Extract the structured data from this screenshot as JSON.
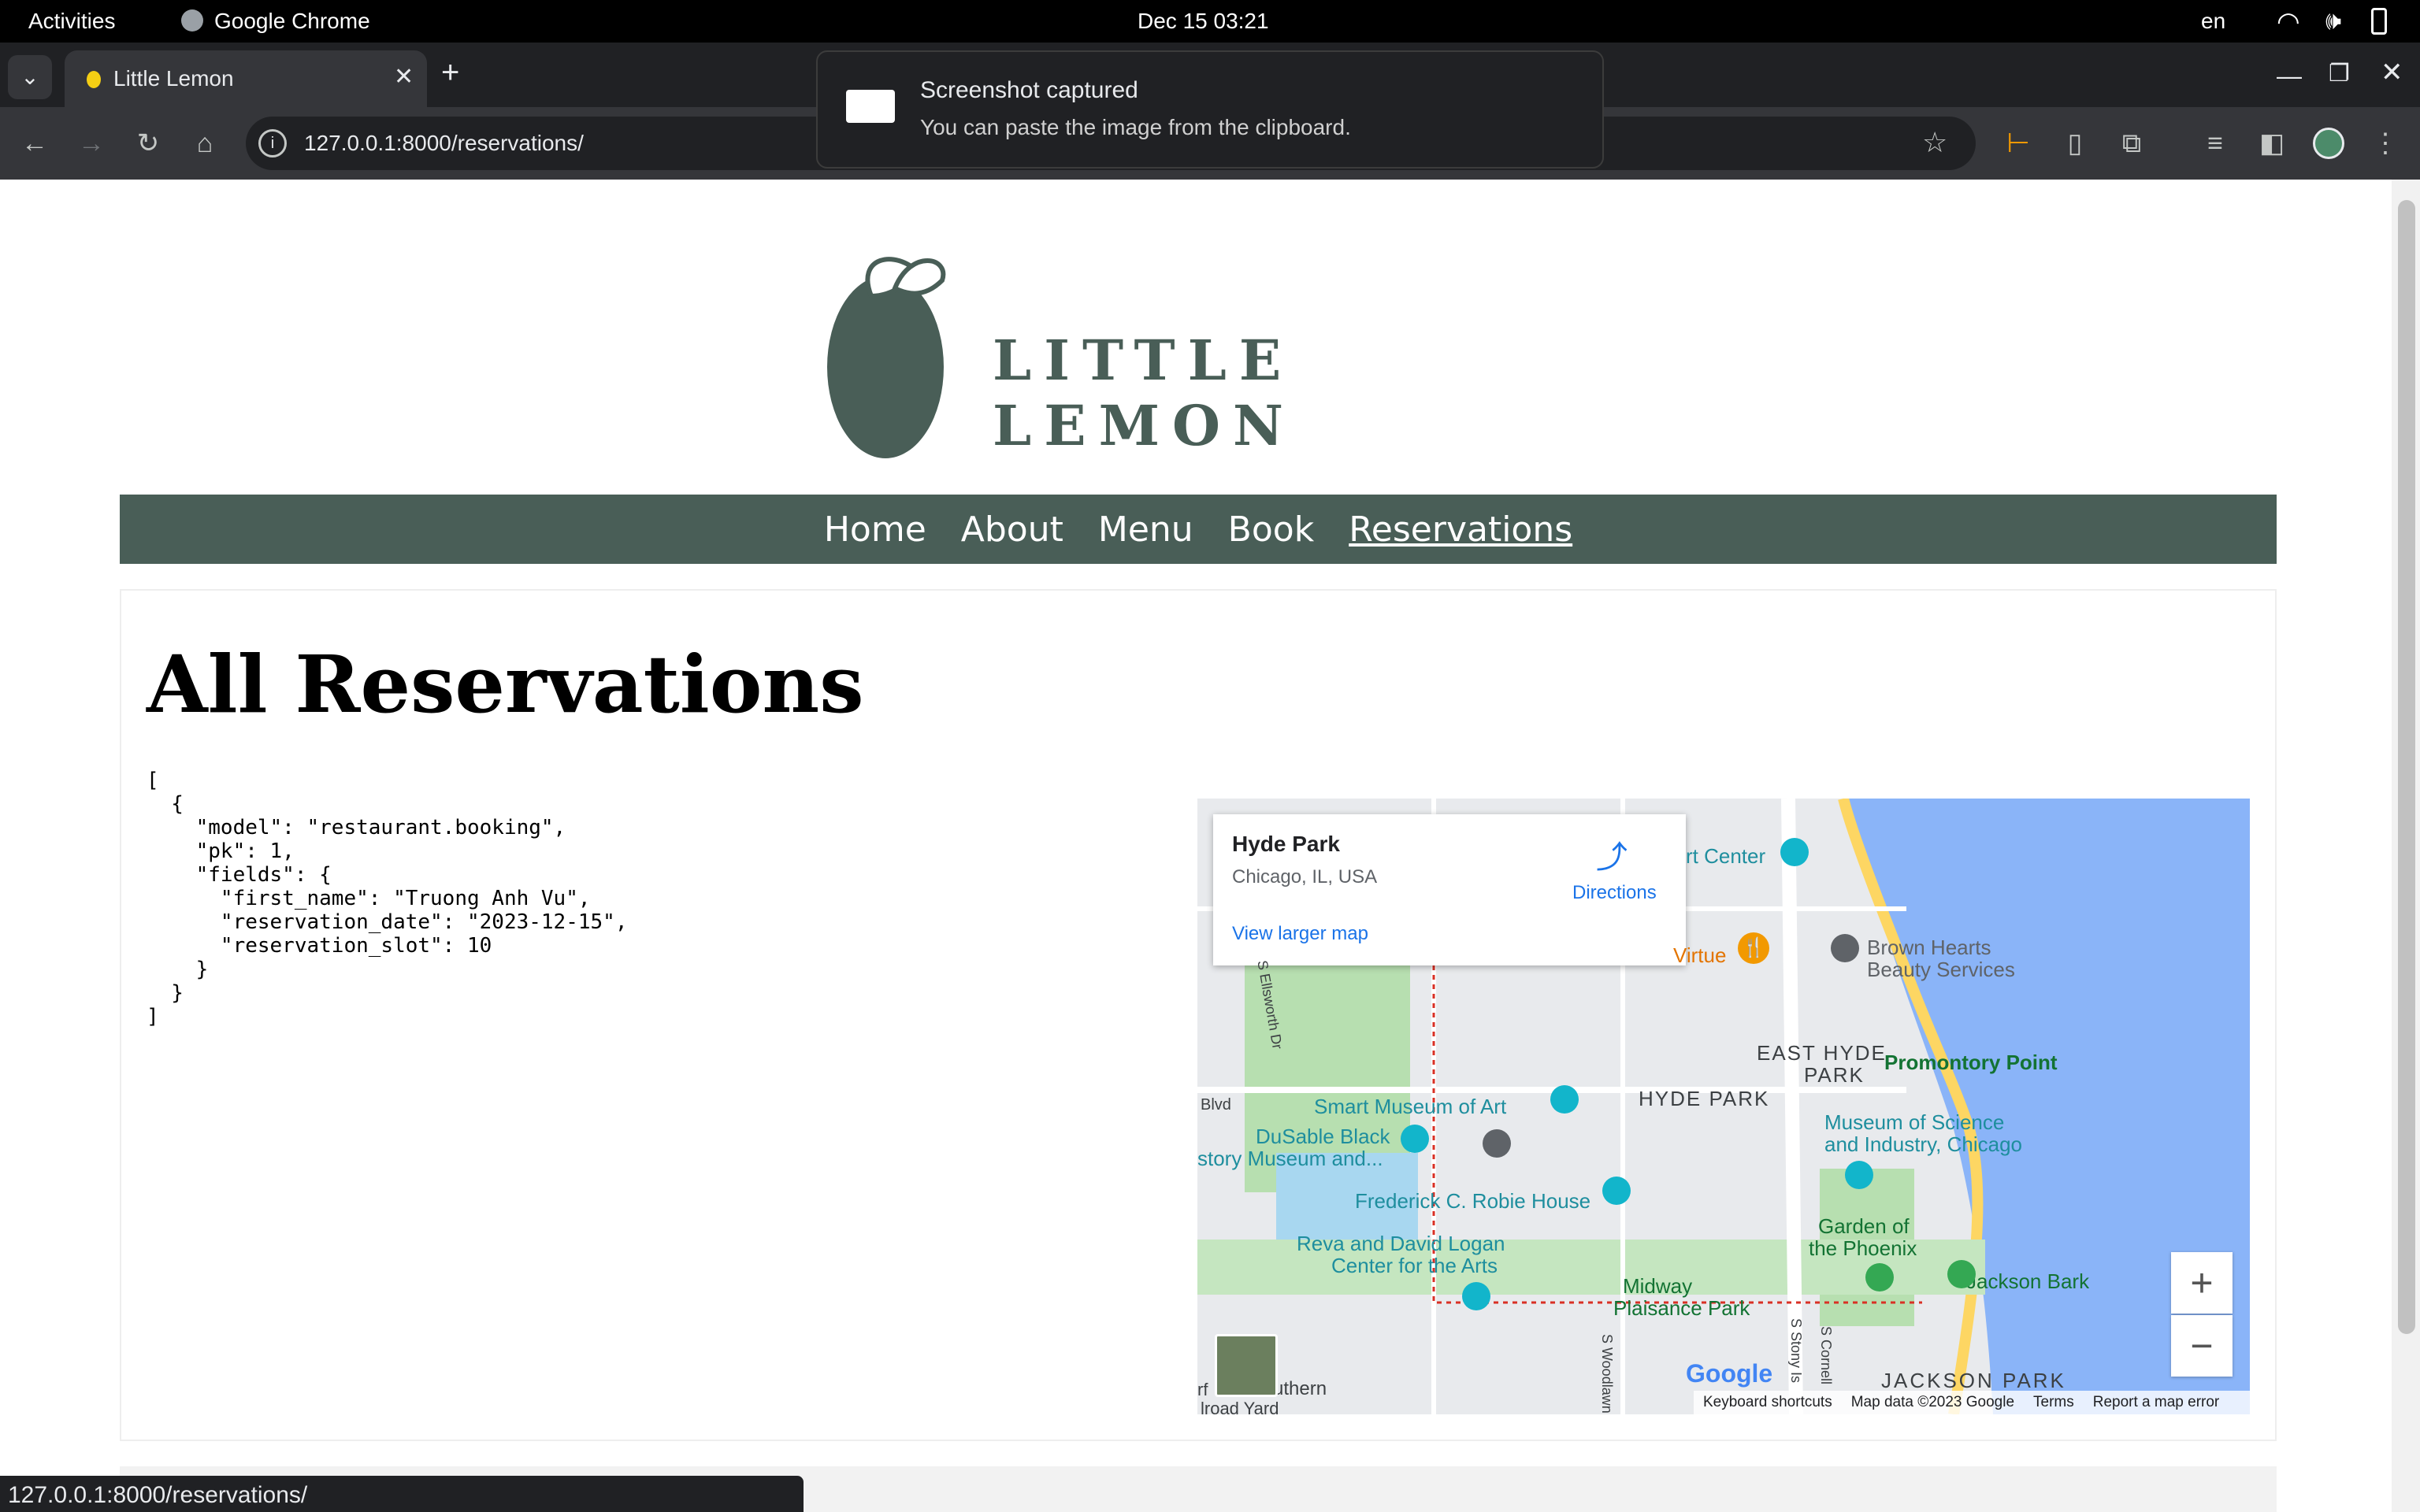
{
  "system_bar": {
    "activities": "Activities",
    "app_name": "Google Chrome",
    "clock": "Dec 15  03:21",
    "language": "en"
  },
  "browser": {
    "tab_title": "Little Lemon",
    "url": "127.0.0.1:8000/reservations/",
    "status_url": "127.0.0.1:8000/reservations/"
  },
  "notification": {
    "title": "Screenshot captured",
    "body": "You can paste the image from the clipboard."
  },
  "site": {
    "brand": "LITTLE LEMON",
    "nav": [
      {
        "label": "Home"
      },
      {
        "label": "About"
      },
      {
        "label": "Menu"
      },
      {
        "label": "Book"
      },
      {
        "label": "Reservations"
      }
    ],
    "heading": "All Reservations",
    "json_dump": "[\n  {\n    \"model\": \"restaurant.booking\",\n    \"pk\": 1,\n    \"fields\": {\n      \"first_name\": \"Truong Anh Vu\",\n      \"reservation_date\": \"2023-12-15\",\n      \"reservation_slot\": 10\n    }\n  }\n]"
  },
  "map": {
    "place_title": "Hyde Park",
    "place_address": "Chicago, IL, USA",
    "directions": "Directions",
    "larger_map": "View larger map",
    "labels": [
      "Brown Hearts",
      "Beauty Services",
      "EAST HYDE",
      "PARK",
      "Promontory Point",
      "HYDE PARK",
      "Museum of Science",
      "and Industry, Chicago",
      "Smart Museum of Art",
      "DuSable Black",
      "story Museum and...",
      "Frederick C. Robie House",
      "Garden of",
      "the Phoenix",
      "Reva and David Logan",
      "Center for the Arts",
      "Midway",
      "Plaisance Park",
      "Jackson Bark",
      "JACKSON PARK",
      "Virtue",
      "rt Center",
      "Blvd",
      "S Ellsworth Dr",
      "S Woodlawn",
      "S Stony Is",
      "S Cornell",
      "rf",
      "uthern",
      "lroad Yard"
    ],
    "attribution": [
      "Keyboard shortcuts",
      "Map data ©2023 Google",
      "Terms",
      "Report a map error"
    ],
    "zoom_in": "+",
    "zoom_out": "−",
    "logo": "Google"
  }
}
